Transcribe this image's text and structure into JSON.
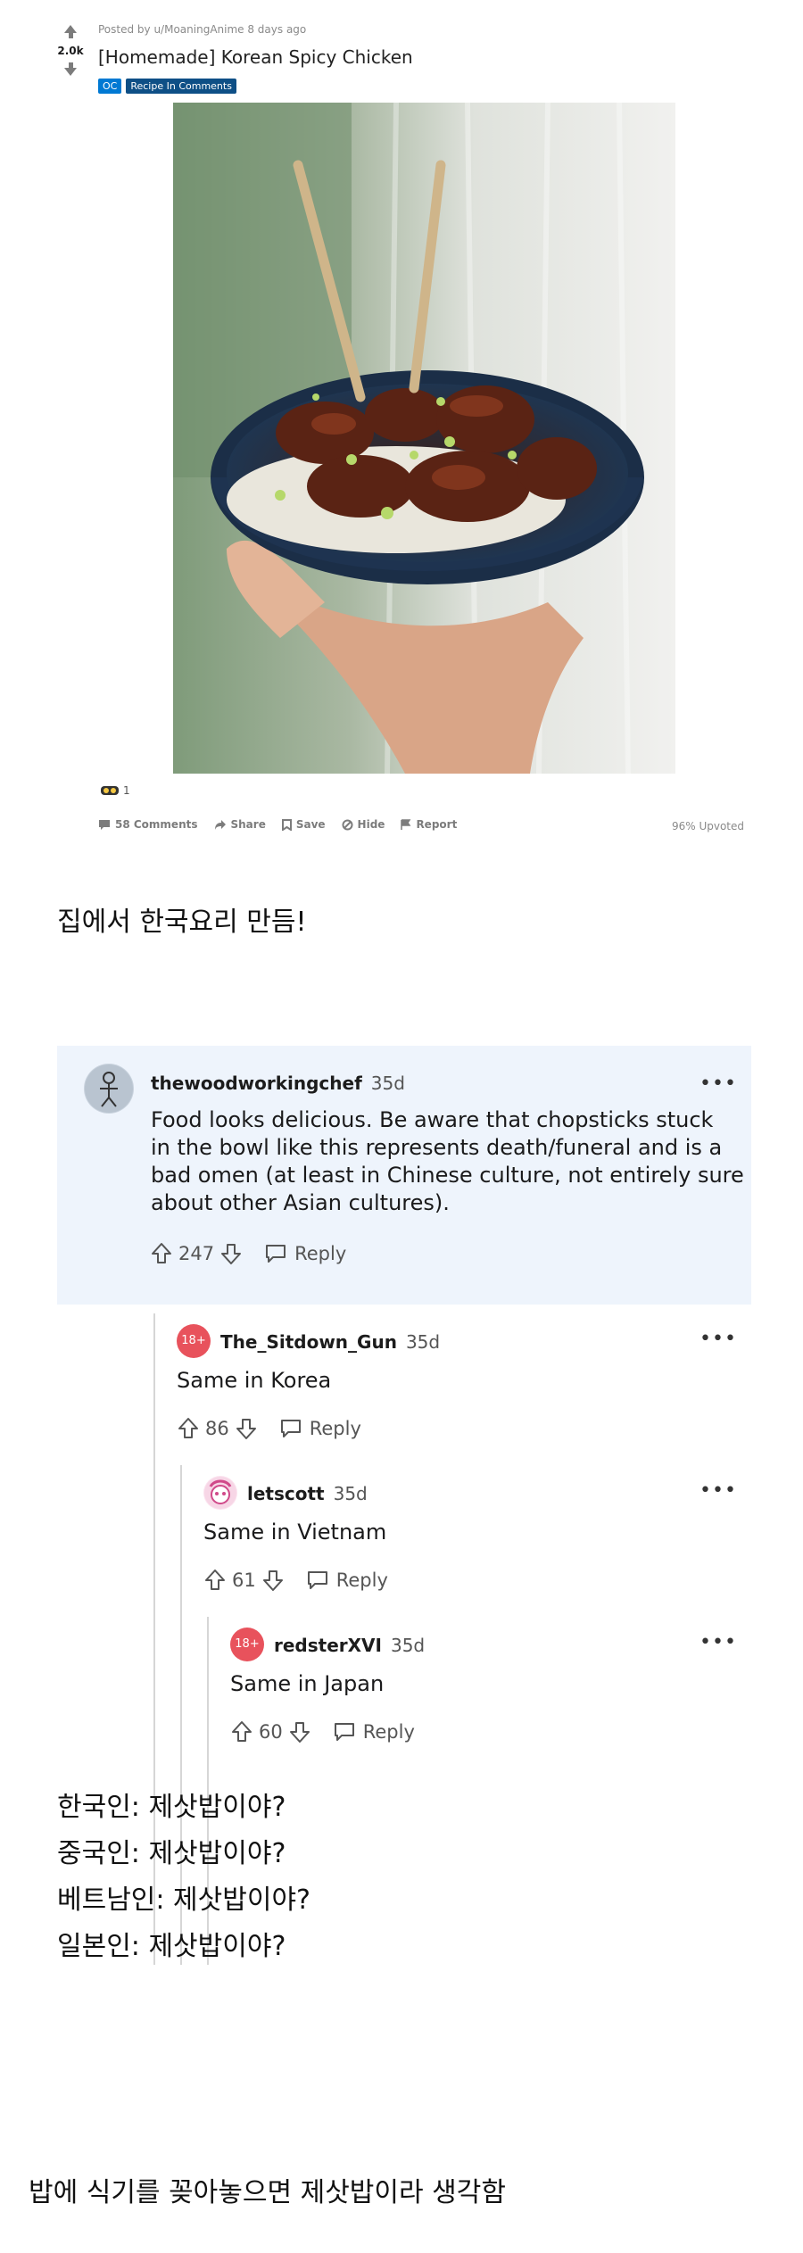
{
  "post": {
    "score": "2.0k",
    "posted_by": "Posted by u/MoaningAnime 8 days ago",
    "title": "[Homemade] Korean Spicy Chicken",
    "flairs": [
      "OC",
      "Recipe In Comments"
    ],
    "award_count": "1",
    "actions": {
      "comments": "58 Comments",
      "share": "Share",
      "save": "Save",
      "hide": "Hide",
      "report": "Report"
    },
    "upvoted": "96% Upvoted"
  },
  "captions": {
    "c1": "집에서 한국요리 만듬!",
    "c2": "한국인: 제삿밥이야?",
    "c3": "중국인:  제삿밥이야?",
    "c4": "베트남인: 제삿밥이야?",
    "c5": "일본인: 제삿밥이야?",
    "c6": "밥에 식기를 꽂아놓으면 제삿밥이라 생각함"
  },
  "comments": [
    {
      "user": "thewoodworkingchef",
      "age": "35d",
      "lines": [
        "Food looks delicious. Be aware that chopsticks stuck",
        "in the bowl like this represents death/funeral and is a",
        "bad omen (at least in Chinese culture, not entirely sure",
        "about other Asian cultures)."
      ],
      "votes": "247",
      "reply": "Reply"
    },
    {
      "user": "The_Sitdown_Gun",
      "age": "35d",
      "avatar_text": "18+",
      "text": "Same in Korea",
      "votes": "86",
      "reply": "Reply"
    },
    {
      "user": "letscott",
      "age": "35d",
      "text": "Same in Vietnam",
      "votes": "61",
      "reply": "Reply"
    },
    {
      "user": "redsterXVI",
      "age": "35d",
      "avatar_text": "18+",
      "text": "Same in Japan",
      "votes": "60",
      "reply": "Reply"
    }
  ],
  "more_label": "•••",
  "colors": {
    "flair_oc": "#0079d3",
    "flair_recipe": "#0e4f86",
    "top_comment_bg": "#eef4fc",
    "nsfw_avatar": "#e8525c"
  }
}
